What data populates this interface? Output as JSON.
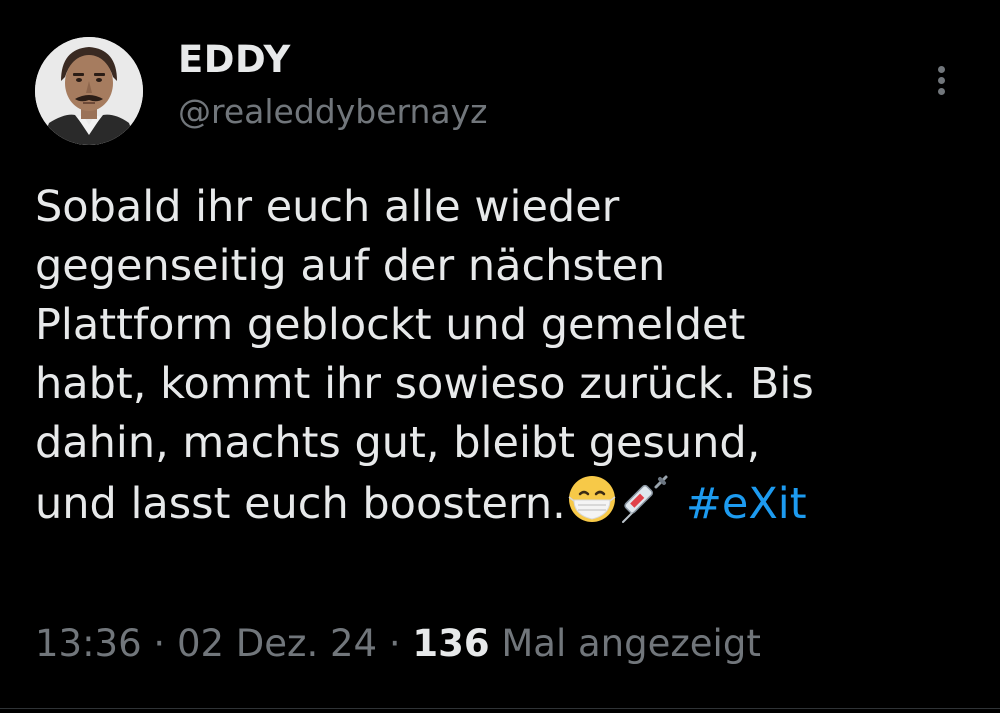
{
  "author": {
    "display_name": "EDDY",
    "handle": "@realeddybernayz",
    "avatar_icon": "profile-photo-man-with-mustache"
  },
  "tweet": {
    "lines": [
      "Sobald ihr euch alle wieder",
      "gegenseitig auf der nächsten",
      "Plattform geblockt und gemeldet",
      "habt, kommt ihr sowieso zurück. Bis",
      "dahin, machts gut, bleibt gesund,",
      "und lasst euch boostern."
    ],
    "emojis": [
      "face-with-medical-mask-emoji",
      "syringe-emoji"
    ],
    "hashtag": "#eXit"
  },
  "meta": {
    "time": "13:36",
    "separator": " · ",
    "date": "02 Dez. 24",
    "views_count": "136",
    "views_label": " Mal angezeigt"
  },
  "colors": {
    "background": "#000000",
    "primary_text": "#e7e9ea",
    "secondary_text": "#71767b",
    "link": "#1d9bf0",
    "divider": "#2f3336"
  },
  "icons": {
    "more": "more-vertical-icon"
  }
}
